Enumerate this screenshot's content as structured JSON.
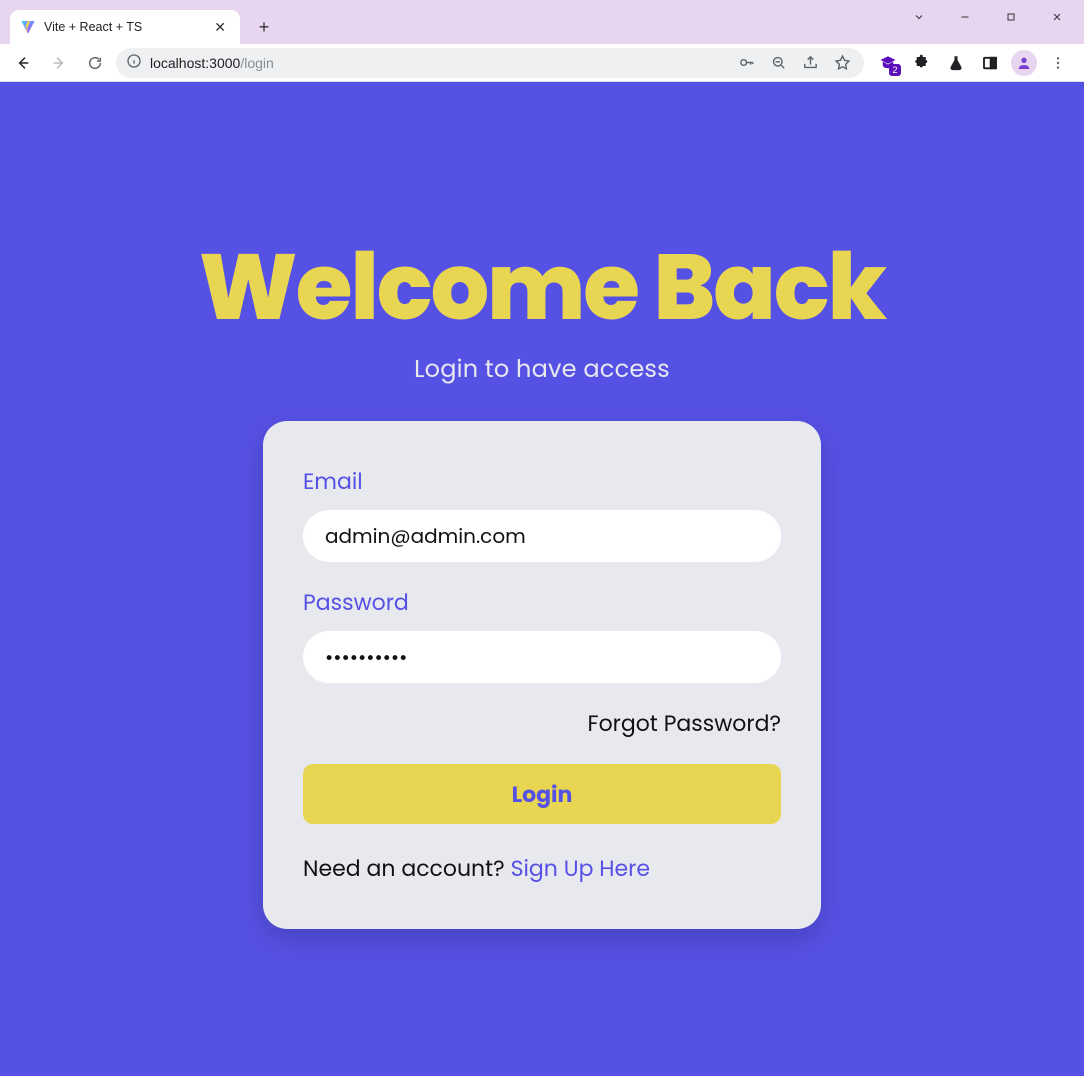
{
  "browser": {
    "tab_title": "Vite + React + TS",
    "new_tab_tooltip": "+",
    "url_host": "localhost:",
    "url_port": "3000",
    "url_path": "/login",
    "extensions_badge": "2"
  },
  "page": {
    "heading": "Welcome Back",
    "subheading": "Login to have access",
    "form": {
      "email_label": "Email",
      "email_value": "admin@admin.com",
      "password_label": "Password",
      "password_value": "••••••••••",
      "forgot_label": "Forgot Password?",
      "submit_label": "Login",
      "signup_prompt": "Need an account? ",
      "signup_link": "Sign Up Here"
    }
  },
  "colors": {
    "page_bg": "#5651e5",
    "accent_yellow": "#e8d653",
    "card_bg": "#e8e8ef"
  }
}
